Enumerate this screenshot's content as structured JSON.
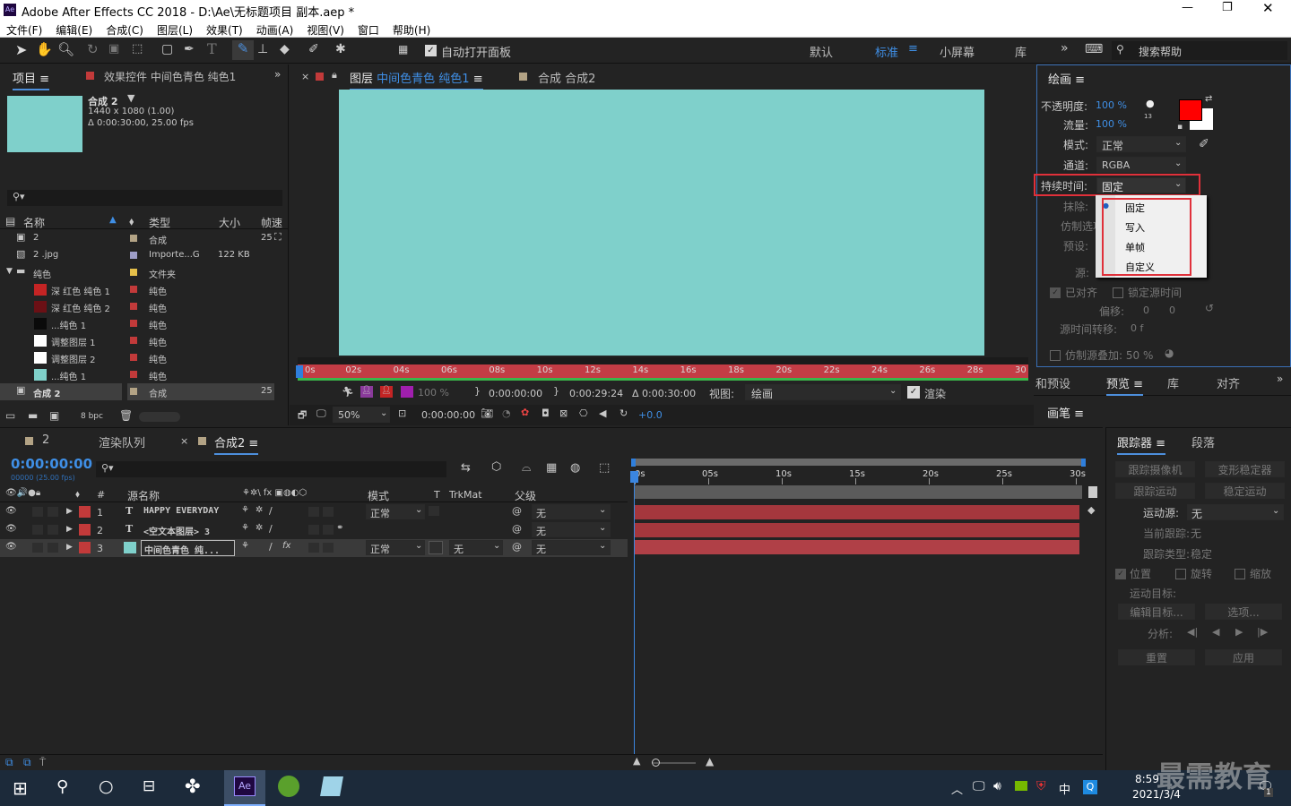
{
  "app": {
    "title": "Adobe After Effects CC 2018 - D:\\Ae\\无标题项目 副本.aep *",
    "logo": "Ae"
  },
  "menu": [
    "文件(F)",
    "编辑(E)",
    "合成(C)",
    "图层(L)",
    "效果(T)",
    "动画(A)",
    "视图(V)",
    "窗口",
    "帮助(H)"
  ],
  "toolbar": {
    "auto_open": "自动打开面板",
    "workspaces": [
      "默认",
      "标准",
      "小屏幕",
      "库"
    ],
    "active_workspace": "标准",
    "search_placeholder": "搜索帮助"
  },
  "project": {
    "tab": "项目",
    "effects_tab": "效果控件 中间色青色 纯色1",
    "comp_name": "合成 2",
    "comp_info1": "1440 x 1080 (1.00)",
    "comp_info2": "Δ 0:00:30:00, 25.00 fps",
    "columns": [
      "名称",
      "类型",
      "大小",
      "帧速"
    ],
    "items": [
      {
        "name": "2",
        "type": "合成",
        "size": "",
        "fps": "25",
        "color": "#b3a385",
        "swatch": "",
        "indent": 0
      },
      {
        "name": "2 .jpg",
        "type": "Importe...G",
        "size": "122 KB",
        "fps": "",
        "color": "#9e9ec8",
        "swatch": "",
        "indent": 0
      },
      {
        "name": "纯色",
        "type": "文件夹",
        "size": "",
        "fps": "",
        "color": "#e6c04a",
        "swatch": "",
        "indent": 0
      },
      {
        "name": "深 红色 纯色 1",
        "type": "纯色",
        "size": "",
        "fps": "",
        "color": "#c23a3a",
        "swatch": "#c42424",
        "indent": 1
      },
      {
        "name": "深 红色 纯色 2",
        "type": "纯色",
        "size": "",
        "fps": "",
        "color": "#c23a3a",
        "swatch": "#6b1015",
        "indent": 1
      },
      {
        "name": "...纯色 1",
        "type": "纯色",
        "size": "",
        "fps": "",
        "color": "#c23a3a",
        "swatch": "#0a0a0a",
        "indent": 1
      },
      {
        "name": "调整图层 1",
        "type": "纯色",
        "size": "",
        "fps": "",
        "color": "#c23a3a",
        "swatch": "#ffffff",
        "indent": 1
      },
      {
        "name": "调整图层 2",
        "type": "纯色",
        "size": "",
        "fps": "",
        "color": "#c23a3a",
        "swatch": "#ffffff",
        "indent": 1
      },
      {
        "name": "...纯色 1",
        "type": "纯色",
        "size": "",
        "fps": "",
        "color": "#c23a3a",
        "swatch": "#7fd0c9",
        "indent": 1
      },
      {
        "name": "合成 2",
        "type": "合成",
        "size": "",
        "fps": "25",
        "color": "#b3a385",
        "swatch": "",
        "indent": 0
      }
    ],
    "bpc": "8 bpc"
  },
  "viewer": {
    "layer_tab": "图层",
    "layer_name": "中间色青色 纯色1",
    "comp_tab": "合成 合成2",
    "ruler": [
      "0s",
      "02s",
      "04s",
      "06s",
      "08s",
      "10s",
      "12s",
      "14s",
      "16s",
      "18s",
      "20s",
      "22s",
      "24s",
      "26s",
      "28s",
      "30"
    ],
    "opacity": "100 %",
    "t_in": "0:00:00:00",
    "t_out": "0:00:29:24",
    "t_dur": "Δ 0:00:30:00",
    "view_label": "视图:",
    "view_value": "绘画",
    "render_label": "渲染",
    "zoom": "50%",
    "time": "0:00:00:00",
    "exposure": "+0.0",
    "canvas_color": "#7fd0cb"
  },
  "paint": {
    "title": "绘画",
    "opacity_label": "不透明度:",
    "opacity": "100 %",
    "flow_label": "流量:",
    "flow": "100 %",
    "mode_label": "模式:",
    "mode": "正常",
    "channel_label": "通道:",
    "channel": "RGBA",
    "duration_label": "持续时间:",
    "duration": "固定",
    "erase_label": "抹除:",
    "clone_label": "仿制选项",
    "preset_label": "预设:",
    "source_label": "源:",
    "aligned": "已对齐",
    "lock_source": "锁定源时间",
    "offset_label": "偏移:",
    "offset_x": "0",
    "offset_y": "0",
    "time_shift_label": "源时间转移:",
    "time_shift": "0 f",
    "overlay": "仿制源叠加: 50 %",
    "brush_size": "13",
    "fg_color": "#ff0000",
    "bg_color": "#ffffff"
  },
  "dropdown": [
    "固定",
    "写入",
    "单帧",
    "自定义"
  ],
  "preview_tabs": [
    "和预设",
    "预览",
    "库",
    "对齐"
  ],
  "brush_tab": "画笔",
  "timeline": {
    "tabs": [
      "2",
      "渲染队列",
      "合成2"
    ],
    "timecode": "0:00:00:00",
    "timecode_sub": "00000 (25.00 fps)",
    "ruler": [
      "0s",
      "05s",
      "10s",
      "15s",
      "20s",
      "25s",
      "30s"
    ],
    "cols": {
      "num": "#",
      "source": "源名称",
      "mode": "模式",
      "trkmat": "TrkMat",
      "parent": "父级"
    },
    "layers": [
      {
        "num": "1",
        "kind": "T",
        "name": "HAPPY EVERYDAY",
        "mode": "正常",
        "trk": "",
        "parent": "无",
        "label": "#c23a3a",
        "swatch": ""
      },
      {
        "num": "2",
        "kind": "T",
        "name": "<空文本图层> 3",
        "mode": "",
        "trk": "",
        "parent": "无",
        "label": "#c23a3a",
        "swatch": ""
      },
      {
        "num": "3",
        "kind": "",
        "name": "中间色青色 纯...",
        "mode": "正常",
        "trk": "无",
        "parent": "无",
        "label": "#c23a3a",
        "swatch": "#7fd0cb"
      }
    ]
  },
  "tracker": {
    "tabs": [
      "跟踪器",
      "段落"
    ],
    "track_camera": "跟踪摄像机",
    "warp": "变形稳定器",
    "track_motion": "跟踪运动",
    "stabilize": "稳定运动",
    "motion_source_label": "运动源:",
    "motion_source": "无",
    "current_track_label": "当前跟踪:",
    "current_track": "无",
    "track_type_label": "跟踪类型:",
    "track_type": "稳定",
    "position": "位置",
    "rotation": "旋转",
    "scale": "缩放",
    "motion_target": "运动目标:",
    "edit_target": "编辑目标...",
    "options": "选项...",
    "analyze": "分析:",
    "reset": "重置",
    "apply": "应用"
  },
  "taskbar": {
    "time": "8:59",
    "date": "2021/3/4",
    "ime": "中",
    "badge": "1",
    "watermark": "最需教育"
  }
}
